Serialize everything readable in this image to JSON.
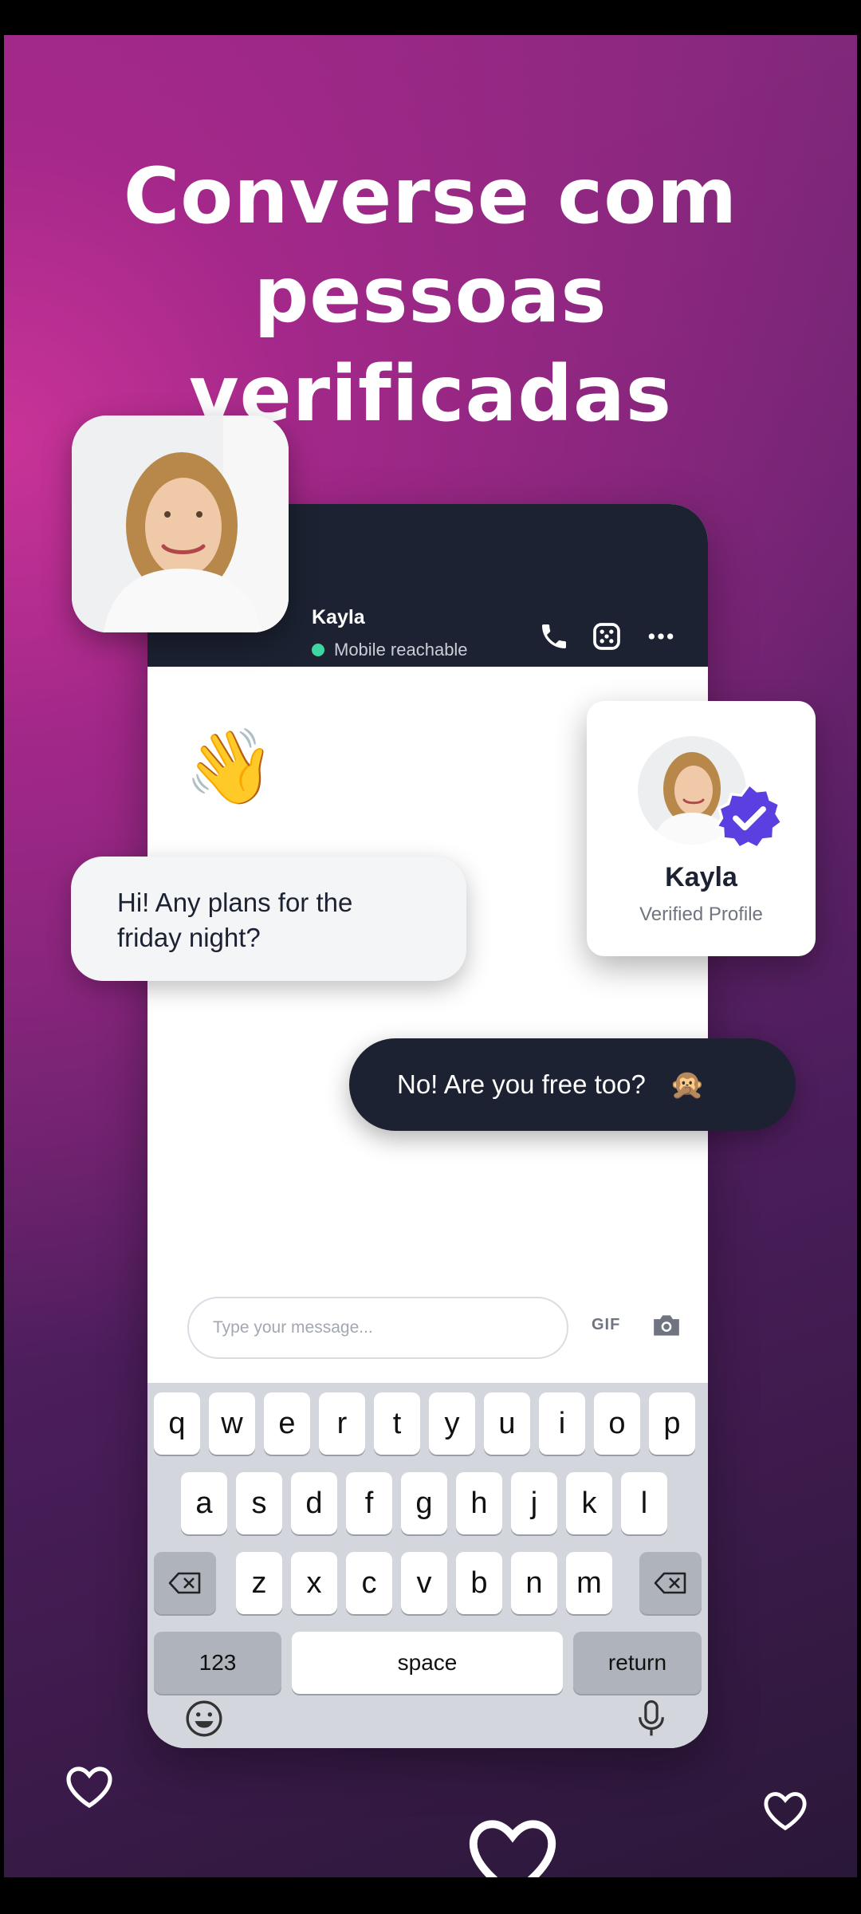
{
  "headline": {
    "line1": "Converse com",
    "line2": "pessoas",
    "line3": "verificadas"
  },
  "chat": {
    "contact_name": "Kayla",
    "status": "Mobile reachable",
    "wave_emoji": "👋",
    "incoming_message": "Hi! Any plans for the friday night?",
    "outgoing_message": "No! Are you free too?",
    "outgoing_emoji": "🙊",
    "input_placeholder": "Type your message...",
    "gif_label": "GIF"
  },
  "verified_card": {
    "name": "Kayla",
    "subtitle": "Verified Profile"
  },
  "keyboard": {
    "row1": [
      "q",
      "w",
      "e",
      "r",
      "t",
      "y",
      "u",
      "i",
      "o",
      "p"
    ],
    "row2": [
      "a",
      "s",
      "d",
      "f",
      "g",
      "h",
      "j",
      "k",
      "l"
    ],
    "row3": [
      "z",
      "x",
      "c",
      "v",
      "b",
      "n",
      "m"
    ],
    "numbers_label": "123",
    "space_label": "space",
    "return_label": "return"
  },
  "colors": {
    "header_dark": "#1c2232",
    "online_green": "#3dd6a3",
    "verified_badge": "#5b3fe0",
    "background_magenta": "#8f2a82"
  },
  "icons": [
    "phone-icon",
    "video-dice-icon",
    "more-icon",
    "camera-icon",
    "backspace-icon",
    "emoji-icon",
    "microphone-icon",
    "heart-icon",
    "verified-badge-icon"
  ]
}
